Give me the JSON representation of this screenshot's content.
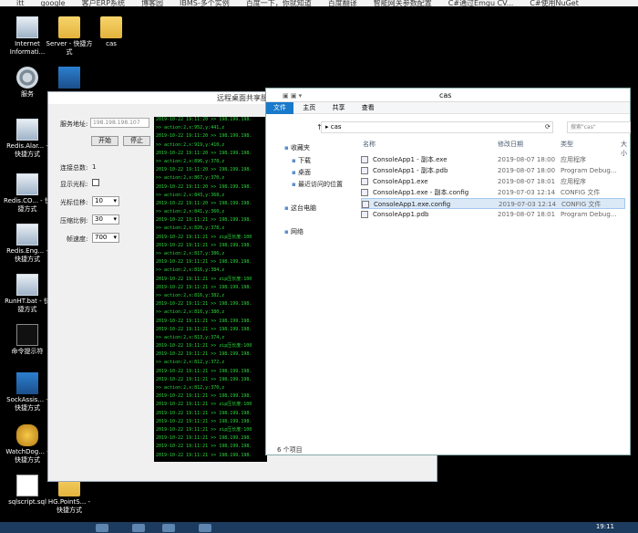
{
  "bookmarks": [
    "",
    "itt",
    "google",
    "客户ERP系统",
    "博客园",
    "IBMS-多个实例",
    "百度一下，你就知道",
    "百度翻译",
    "智能网关参数配置",
    "C#通过Emgu CV...",
    "C#使用NuGet"
  ],
  "desktop_icons": [
    {
      "label": "Internet Informati...",
      "type": "app"
    },
    {
      "label": "Server - 快捷方式",
      "type": "folder"
    },
    {
      "label": "cas",
      "type": "folder"
    },
    {
      "label": "服务",
      "type": "gear"
    },
    {
      "label": "",
      "type": "net"
    },
    {
      "label": "Redis.Alar... - 快捷方式",
      "type": "app"
    },
    {
      "label": "Redis.CO... - 快捷方式",
      "type": "app"
    },
    {
      "label": "Redis.Eng... - 快捷方式",
      "type": "app"
    },
    {
      "label": "RunHT.bat - 快捷方式",
      "type": "app"
    },
    {
      "label": "命令提示符",
      "type": "cmd"
    },
    {
      "label": "SockAssis... - 快捷方式",
      "type": "net"
    },
    {
      "label": "WatchDog... - 快捷方式",
      "type": "gold"
    },
    {
      "label": "sqlscript.sql",
      "type": "doc"
    },
    {
      "label": "HG.PointS... - 快捷方式",
      "type": "folder"
    }
  ],
  "rdp": {
    "title": "远程桌面共享服",
    "server_label": "服务地址:",
    "server_value": "198.198.198.107",
    "start_btn": "开始",
    "stop_btn": "停止",
    "conn_label": "连接总数:",
    "conn_value": "1",
    "cursor_label": "显示光标:",
    "rate_label": "光标位移:",
    "rate_value": "10",
    "zoom_label": "压缩比例:",
    "zoom_value": "30",
    "fps_label": "帧速度:",
    "fps_value": "700"
  },
  "console_lines": [
    "2019-10-22 19:11:20 >> 198.199.198.",
    ">> action:2,x:952,y:441,z",
    "2019-10-22 19:11:20 >> 198.199.198.",
    ">> action:2,x:919,y:410,z",
    "2019-10-22 19:11:20 >> 198.199.198.",
    ">> action:2,x:896,y:378,z",
    "2019-10-22 19:11:20 >> 198.199.198.",
    ">> action:2,x:867,y:370,z",
    "2019-10-22 19:11:20 >> 198.199.198.",
    ">> action:2,x:843,y:368,z",
    "2019-10-22 19:11:20 >> 198.199.198.",
    ">> action:2,x:841,y:360,z",
    "2019-10-22 19:11:21 >> 198.199.198.",
    ">> action:2,x:820,y:378,z",
    "2019-10-22 19:11:21 >> zip压长度:100",
    "2019-10-22 19:11:21 >> 198.199.198.",
    ">> action:2,x:817,y:386,z",
    "2019-10-22 19:11:21 >> 198.199.198.",
    ">> action:2,x:816,y:384,z",
    "2019-10-22 19:11:21 >> zip压长度:100",
    "2019-10-22 19:11:21 >> 198.199.198.",
    ">> action:2,x:816,y:382,z",
    "2019-10-22 19:11:21 >> 198.199.198.",
    ">> action:2,x:816,y:380,z",
    "2019-10-22 19:11:21 >> 198.199.198.",
    "2019-10-22 19:11:21 >> 198.199.198.",
    ">> action:2,x:813,y:374,z",
    "2019-10-22 19:11:21 >> zip压长度:100",
    "2019-10-22 19:11:21 >> 198.199.198.",
    ">> action:2,x:812,y:372,z",
    "2019-10-22 19:11:21 >> 198.199.198.",
    "2019-10-22 19:11:21 >> 198.199.198.",
    ">> action:2,x:812,y:370,z",
    "2019-10-22 19:11:21 >> 198.199.198.",
    "2019-10-22 19:11:21 >> zip压长度:100",
    "2019-10-22 19:11:21 >> 198.199.198.",
    "2019-10-22 19:11:21 >> 198.199.198.",
    "2019-10-22 19:11:21 >> zip压长度:100",
    "2019-10-22 19:11:21 >> 198.199.198.",
    "2019-10-22 19:11:21 >> 198.199.198.",
    "2019-10-22 19:11:21 >> 198.199.198."
  ],
  "explorer": {
    "title": "cas",
    "tabs": [
      "文件",
      "主页",
      "共享",
      "查看"
    ],
    "address": "cas",
    "search_placeholder": "搜索\"cas\"",
    "nav": [
      "收藏夹",
      "下载",
      "桌面",
      "最近访问的位置",
      "这台电脑",
      "网络"
    ],
    "columns": [
      "名称",
      "修改日期",
      "类型",
      "大小"
    ],
    "files": [
      {
        "name": "ConsoleApp1 - 副本.exe",
        "date": "2019-08-07 18:00",
        "type": "应用程序"
      },
      {
        "name": "ConsoleApp1 - 副本.pdb",
        "date": "2019-08-07 18:00",
        "type": "Program Debug..."
      },
      {
        "name": "ConsoleApp1.exe",
        "date": "2019-08-07 18:01",
        "type": "应用程序"
      },
      {
        "name": "ConsoleApp1.exe - 副本.config",
        "date": "2019-07-03 12:14",
        "type": "CONFIG 文件"
      },
      {
        "name": "ConsoleApp1.exe.config",
        "date": "2019-07-03 12:14",
        "type": "CONFIG 文件"
      },
      {
        "name": "ConsoleApp1.pdb",
        "date": "2019-08-07 18:01",
        "type": "Program Debug..."
      }
    ],
    "status": "6 个项目"
  },
  "taskbar": {
    "clock": "19:11"
  }
}
